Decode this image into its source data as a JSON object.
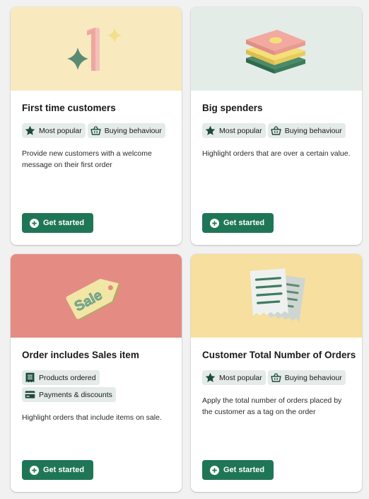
{
  "cards": [
    {
      "title": "First time customers",
      "hero_color": "#f8e9bf",
      "hero_icon": "sparkle-number-one-icon",
      "tags": [
        {
          "icon": "star-icon",
          "label": "Most popular"
        },
        {
          "icon": "shopping-basket-icon",
          "label": "Buying behaviour"
        }
      ],
      "description": "Provide new customers with a welcome message on their first order",
      "button_label": "Get started"
    },
    {
      "title": "Big spenders",
      "hero_color": "#e4ece7",
      "hero_icon": "money-stack-icon",
      "tags": [
        {
          "icon": "star-icon",
          "label": "Most popular"
        },
        {
          "icon": "shopping-basket-icon",
          "label": "Buying behaviour"
        }
      ],
      "description": "Highlight orders that are over a certain value.",
      "button_label": "Get started"
    },
    {
      "title": "Order includes Sales item",
      "hero_color": "#e48c84",
      "hero_icon": "sale-tag-icon",
      "hero_text": "Sale",
      "tags": [
        {
          "icon": "receipt-icon",
          "label": "Products ordered"
        },
        {
          "icon": "credit-card-icon",
          "label": "Payments & discounts"
        }
      ],
      "description": "Highlight orders that include items on sale.",
      "button_label": "Get started"
    },
    {
      "title": "Customer Total Number of Orders",
      "hero_color": "#f6df9f",
      "hero_icon": "receipts-icon",
      "tags": [
        {
          "icon": "star-icon",
          "label": "Most popular"
        },
        {
          "icon": "shopping-basket-icon",
          "label": "Buying behaviour"
        }
      ],
      "description": "Apply the total number of orders placed by the customer as a tag on the order",
      "button_label": "Get started"
    }
  ],
  "colors": {
    "button": "#1f7656",
    "tag_bg": "#e4ebe8",
    "page_bg": "#f1f1f1",
    "icon_green": "#1e4a3a"
  }
}
